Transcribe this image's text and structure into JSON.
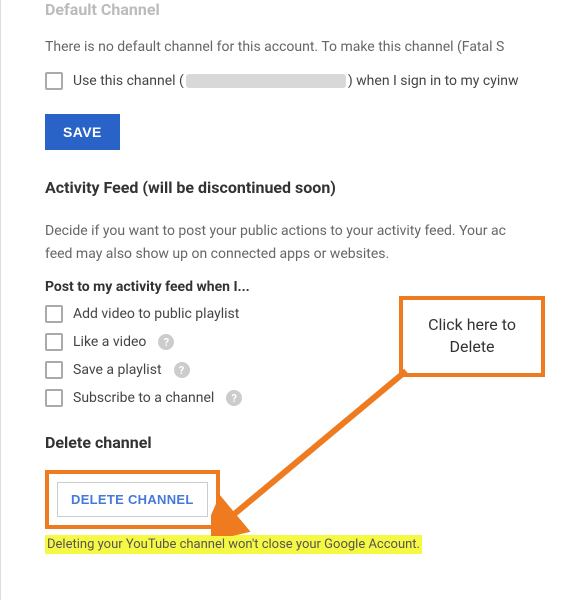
{
  "default_channel": {
    "title": "Default Channel",
    "desc_prefix": "There is no default channel for this account. To make this channel (Fatal S",
    "use_prefix": "Use this channel (",
    "use_suffix": ") when I sign in to my cyinw",
    "save_label": "SAVE"
  },
  "activity_feed": {
    "title": "Activity Feed (will be discontinued soon)",
    "desc": "Decide if you want to post your public actions to your activity feed. Your ac",
    "desc2": "feed may also show up on connected apps or websites.",
    "sub_label": "Post to my activity feed when I...",
    "options": [
      "Add video to public playlist",
      "Like a video",
      "Save a playlist",
      "Subscribe to a channel"
    ]
  },
  "delete_channel": {
    "title": "Delete channel",
    "button_label": "DELETE CHANNEL",
    "warning": "Deleting your YouTube channel won't close your Google Account."
  },
  "callout": {
    "line1": "Click here to",
    "line2": "Delete"
  }
}
